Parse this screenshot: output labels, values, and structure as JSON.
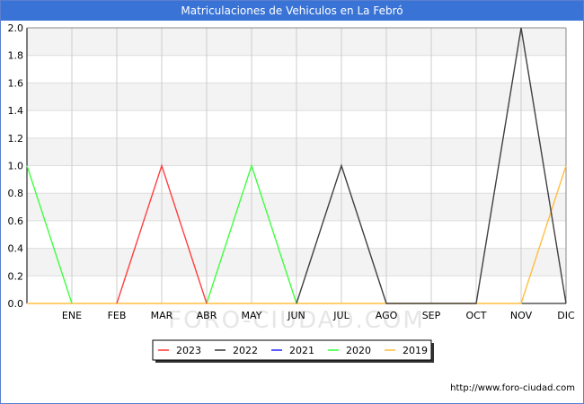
{
  "title": "Matriculaciones de Vehiculos en La Febró",
  "watermark": "FORO-CIUDAD.COM",
  "footer": "http://www.foro-ciudad.com",
  "chart_data": {
    "type": "line",
    "title": "Matriculaciones de Vehiculos en La Febró",
    "x": [
      "",
      "ENE",
      "FEB",
      "MAR",
      "ABR",
      "MAY",
      "JUN",
      "JUL",
      "AGO",
      "SEP",
      "OCT",
      "NOV",
      "DIC"
    ],
    "ylim": [
      0,
      2
    ],
    "yticks": [
      "0.0",
      "0.2",
      "0.4",
      "0.6",
      "0.8",
      "1.0",
      "1.2",
      "1.4",
      "1.6",
      "1.8",
      "2.0"
    ],
    "grid": true,
    "legend_position": "bottom",
    "series": [
      {
        "name": "2023",
        "color": "#ff4040",
        "values": [
          null,
          null,
          0,
          1,
          0,
          null,
          null,
          null,
          null,
          null,
          null,
          null,
          null
        ]
      },
      {
        "name": "2022",
        "color": "#404040",
        "values": [
          null,
          null,
          null,
          null,
          null,
          null,
          0,
          1,
          0,
          0,
          0,
          2,
          0
        ]
      },
      {
        "name": "2021",
        "color": "#3030ff",
        "values": []
      },
      {
        "name": "2020",
        "color": "#40ff40",
        "values": [
          1,
          0,
          null,
          null,
          0,
          1,
          0,
          null,
          null,
          null,
          null,
          null,
          null
        ]
      },
      {
        "name": "2019",
        "color": "#ffbf40",
        "values": [
          0,
          0,
          0,
          0,
          0,
          0,
          0,
          0,
          0,
          0,
          0,
          0,
          1
        ]
      }
    ]
  }
}
